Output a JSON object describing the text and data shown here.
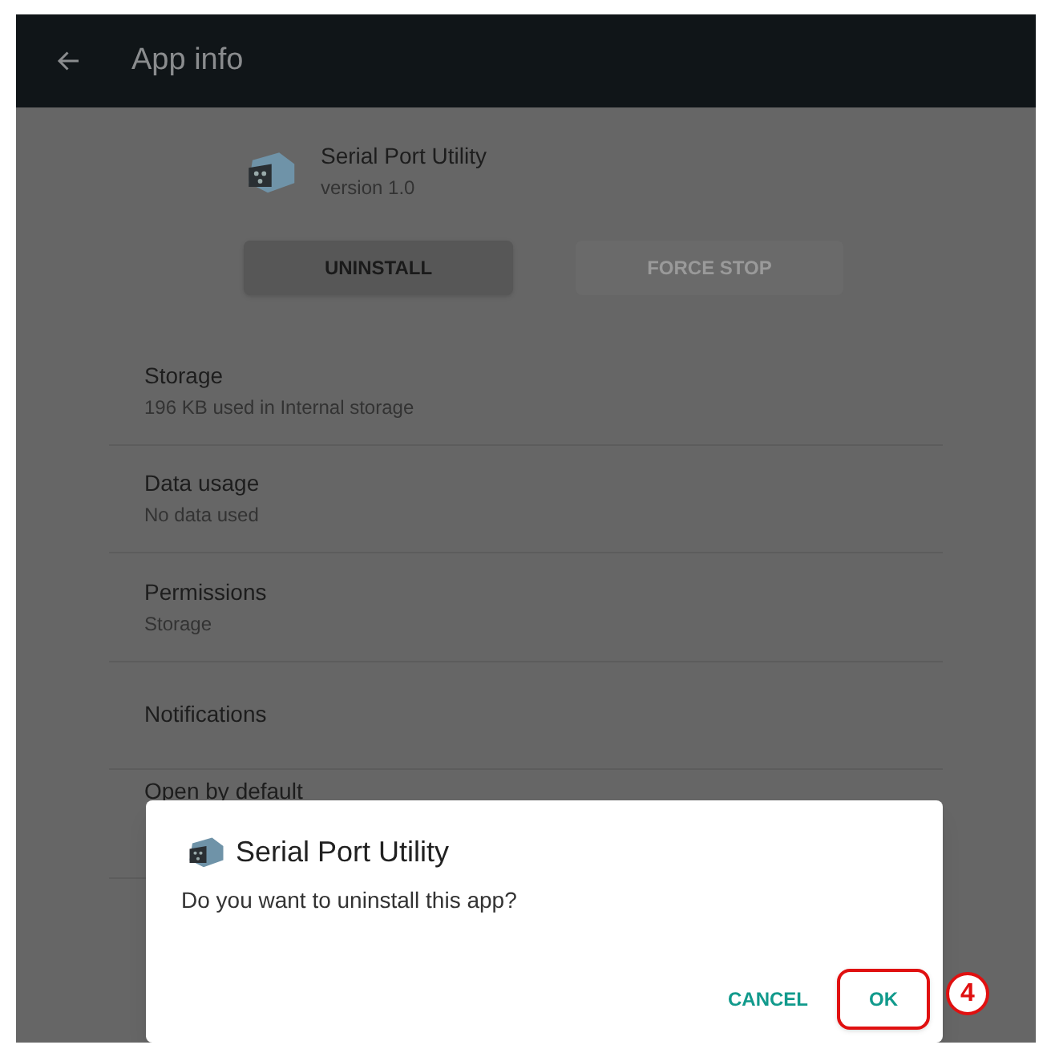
{
  "toolbar": {
    "title": "App info"
  },
  "app": {
    "name": "Serial Port Utility",
    "version": "version 1.0"
  },
  "actions": [
    {
      "label": "UNINSTALL",
      "disabled": false
    },
    {
      "label": "FORCE STOP",
      "disabled": true
    }
  ],
  "settings": [
    {
      "title": "Storage",
      "subtitle": "196 KB used in Internal storage"
    },
    {
      "title": "Data usage",
      "subtitle": "No data used"
    },
    {
      "title": "Permissions",
      "subtitle": "Storage"
    },
    {
      "title": "Notifications"
    },
    {
      "title": "Open by default"
    }
  ],
  "dialog": {
    "title": "Serial Port Utility",
    "message": "Do you want to uninstall this app?",
    "buttons": [
      {
        "label": "CANCEL",
        "highlighted": false
      },
      {
        "label": "OK",
        "highlighted": true
      }
    ]
  },
  "callout": {
    "number": "4"
  }
}
